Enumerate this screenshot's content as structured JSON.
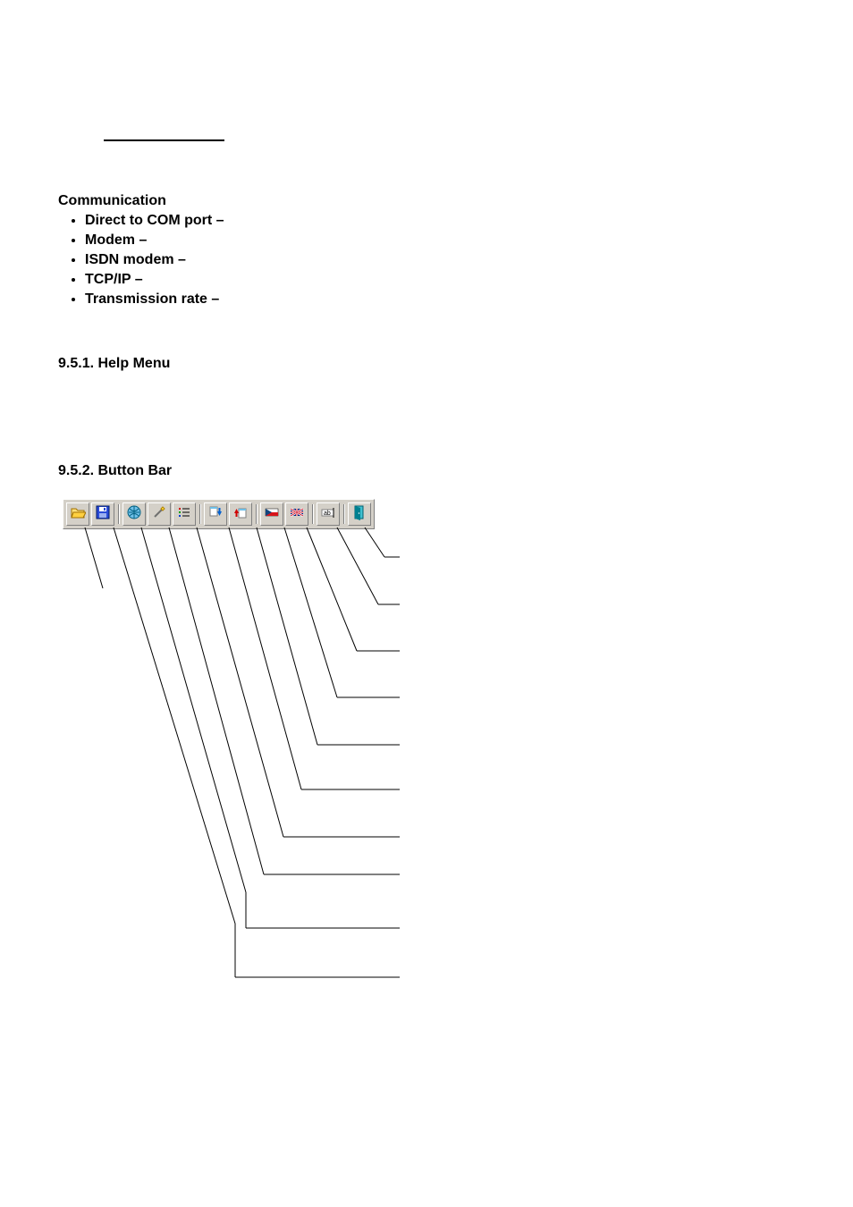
{
  "communication": {
    "heading": "Communication",
    "items": [
      "Direct to COM port –",
      "Modem –",
      "ISDN modem –",
      "TCP/IP –",
      "Transmission rate –"
    ]
  },
  "sections": {
    "help_menu": "9.5.1.  Help Menu",
    "button_bar": "9.5.2.  Button Bar"
  },
  "toolbar": {
    "buttons": [
      {
        "name": "open-folder-icon"
      },
      {
        "name": "save-disk-icon"
      },
      {
        "sep": true
      },
      {
        "name": "globe-icon"
      },
      {
        "name": "wand-icon"
      },
      {
        "name": "list-icon"
      },
      {
        "sep": true
      },
      {
        "name": "download-icon"
      },
      {
        "name": "upload-icon"
      },
      {
        "sep": true
      },
      {
        "name": "flag-czech-icon"
      },
      {
        "name": "flag-uk-icon"
      },
      {
        "sep": true
      },
      {
        "name": "rename-icon"
      },
      {
        "sep": true
      },
      {
        "name": "exit-door-icon"
      }
    ]
  }
}
